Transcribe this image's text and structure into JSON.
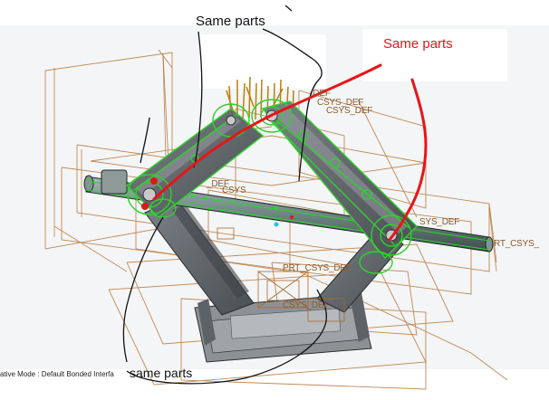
{
  "annotations": {
    "top_label": "Same parts",
    "red_label": "Same parts",
    "bottom_label": "same parts"
  },
  "model_labels": {
    "csys_1": "_DEF",
    "csys_2": "CSYS_DEF",
    "csys_3": "CSYS_DEF",
    "csys_4": "_DEF",
    "csys_5": "CSYS",
    "csys_6": "SYS_DEF",
    "csys_7": "RT_CSYS_",
    "csys_8": "PRT_CSYS_DEF",
    "csys_9": "CSYS_DEF"
  },
  "status_bar": {
    "text": "ative Mode : Default Bonded Interfa"
  },
  "colors": {
    "wireframe": "#b5773a",
    "part_body": "#5a5f63",
    "highlight_edges": "#2fd12f",
    "annotation_red": "#e8141a",
    "annotation_black": "#111111"
  }
}
